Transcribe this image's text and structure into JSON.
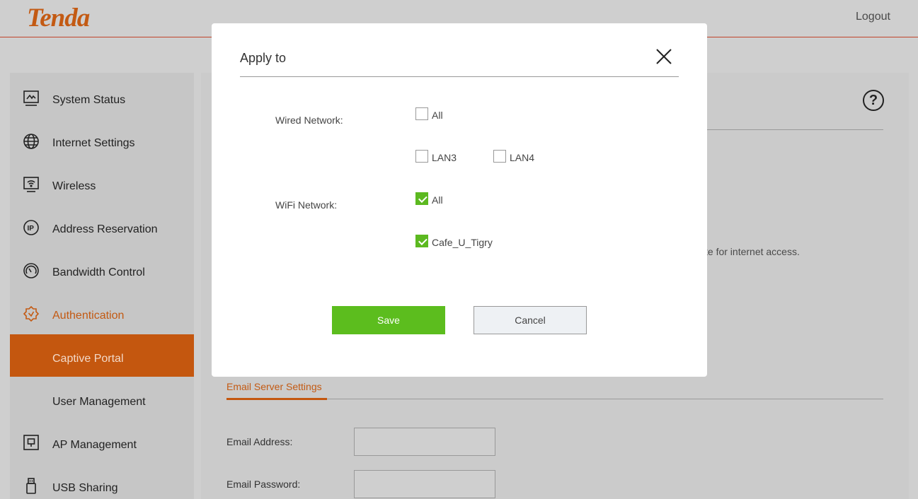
{
  "header": {
    "logo": "Tenda",
    "logout_label": "Logout"
  },
  "sidebar": {
    "items": [
      {
        "label": "System Status",
        "icon": "monitor-graph-icon"
      },
      {
        "label": "Internet Settings",
        "icon": "globe-icon"
      },
      {
        "label": "Wireless",
        "icon": "wifi-monitor-icon"
      },
      {
        "label": "Address Reservation",
        "icon": "ip-icon"
      },
      {
        "label": "Bandwidth Control",
        "icon": "gauge-icon"
      },
      {
        "label": "Authentication",
        "icon": "shield-check-icon",
        "state": "expanded"
      },
      {
        "label": "Captive Portal",
        "state": "active"
      },
      {
        "label": "User Management"
      },
      {
        "label": "AP Management",
        "icon": "ap-device-icon"
      },
      {
        "label": "USB Sharing",
        "icon": "usb-icon"
      }
    ]
  },
  "main": {
    "help_icon": "?",
    "partial_text": "te for internet access.",
    "email_tab": "Email Server Settings",
    "email_address_label": "Email Address:",
    "email_address_value": "",
    "email_password_label": "Email Password:",
    "email_password_value": ""
  },
  "modal": {
    "title": "Apply to",
    "wired_label": "Wired Network:",
    "wired_options": [
      {
        "label": "All",
        "checked": false
      },
      {
        "label": "LAN3",
        "checked": false
      },
      {
        "label": "LAN4",
        "checked": false
      }
    ],
    "wifi_label": "WiFi Network:",
    "wifi_options": [
      {
        "label": "All",
        "checked": true
      },
      {
        "label": "Cafe_U_Tigry",
        "checked": true
      }
    ],
    "save_label": "Save",
    "cancel_label": "Cancel"
  },
  "colors": {
    "accent": "#c4570f",
    "save_green": "#5cbd1e",
    "check_green": "#5cb920"
  }
}
